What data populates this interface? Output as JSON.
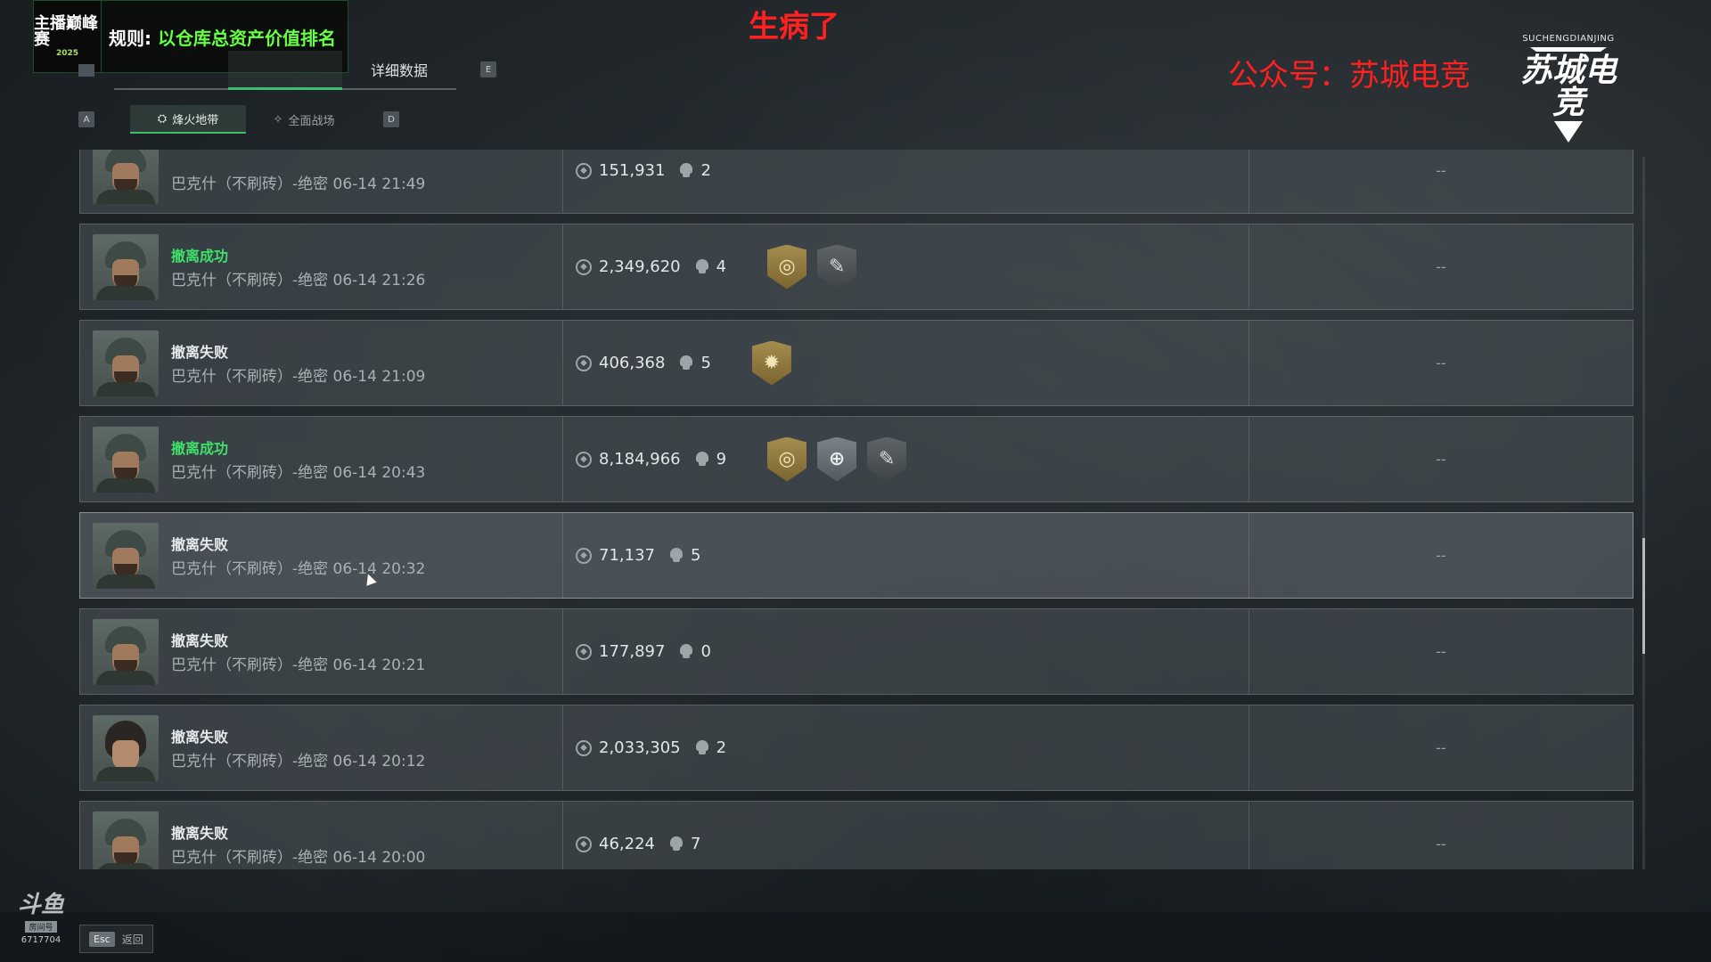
{
  "overlay": {
    "banner_logo_main": "主播巅峰赛",
    "banner_logo_year": "2025",
    "rule_prefix": "规则:",
    "rule_text": "以仓库总资产价值排名",
    "top_title": "生病了",
    "wechat": "公众号：苏城电竞",
    "brand_en": "SUCHENGDIANJING",
    "brand_cn": "苏城电竞"
  },
  "tabs": {
    "items": [
      {
        "label": ""
      },
      {
        "label": ""
      },
      {
        "label": "详细数据"
      }
    ],
    "key_right": "E",
    "key_left": ""
  },
  "subtabs": {
    "key_left": "A",
    "key_right": "D",
    "items": [
      {
        "label": "烽火地带",
        "icon": "flame-zone-icon"
      },
      {
        "label": "全面战场",
        "icon": "battlefield-icon"
      }
    ]
  },
  "records": [
    {
      "status": "",
      "status_type": "failed",
      "detail": "巴克什（不刷砖）-绝密 06-14 21:49",
      "value": "151,931",
      "kills": "2",
      "badges": [],
      "extra": "--"
    },
    {
      "status": "撤离成功",
      "status_type": "success",
      "detail": "巴克什（不刷砖）-绝密 06-14 21:26",
      "value": "2,349,620",
      "kills": "4",
      "badges": [
        "gold-coin-badge",
        "dark-gun-badge"
      ],
      "extra": "--"
    },
    {
      "status": "撤离失败",
      "status_type": "failed",
      "detail": "巴克什（不刷砖）-绝密 06-14 21:09",
      "value": "406,368",
      "kills": "5",
      "badges": [
        "gold-star-badge"
      ],
      "extra": "--"
    },
    {
      "status": "撤离成功",
      "status_type": "success",
      "detail": "巴克什（不刷砖）-绝密 06-14 20:43",
      "value": "8,184,966",
      "kills": "9",
      "badges": [
        "gold-coin-badge",
        "silver-crosshair-badge",
        "dark-gun-badge"
      ],
      "extra": "--"
    },
    {
      "status": "撤离失败",
      "status_type": "failed",
      "detail": "巴克什（不刷砖）-绝密 06-14 20:32",
      "value": "71,137",
      "kills": "5",
      "badges": [],
      "extra": "--"
    },
    {
      "status": "撤离失败",
      "status_type": "failed",
      "detail": "巴克什（不刷砖）-绝密 06-14 20:21",
      "value": "177,897",
      "kills": "0",
      "badges": [],
      "extra": "--"
    },
    {
      "status": "撤离失败",
      "status_type": "failed",
      "detail": "巴克什（不刷砖）-绝密 06-14 20:12",
      "value": "2,033,305",
      "kills": "2",
      "badges": [],
      "extra": "--"
    },
    {
      "status": "撤离失败",
      "status_type": "failed",
      "detail": "巴克什（不刷砖）-绝密 06-14 20:00",
      "value": "46,224",
      "kills": "7",
      "badges": [],
      "extra": "--"
    }
  ],
  "footer": {
    "esc_key": "Esc",
    "esc_label": "返回",
    "douyu_logo": "斗鱼",
    "douyu_tag": "房间号",
    "room_id": "6717704"
  },
  "colors": {
    "success": "#3fe06a",
    "accent_green": "#3ebe6a",
    "overlay_red": "#ff2020"
  }
}
